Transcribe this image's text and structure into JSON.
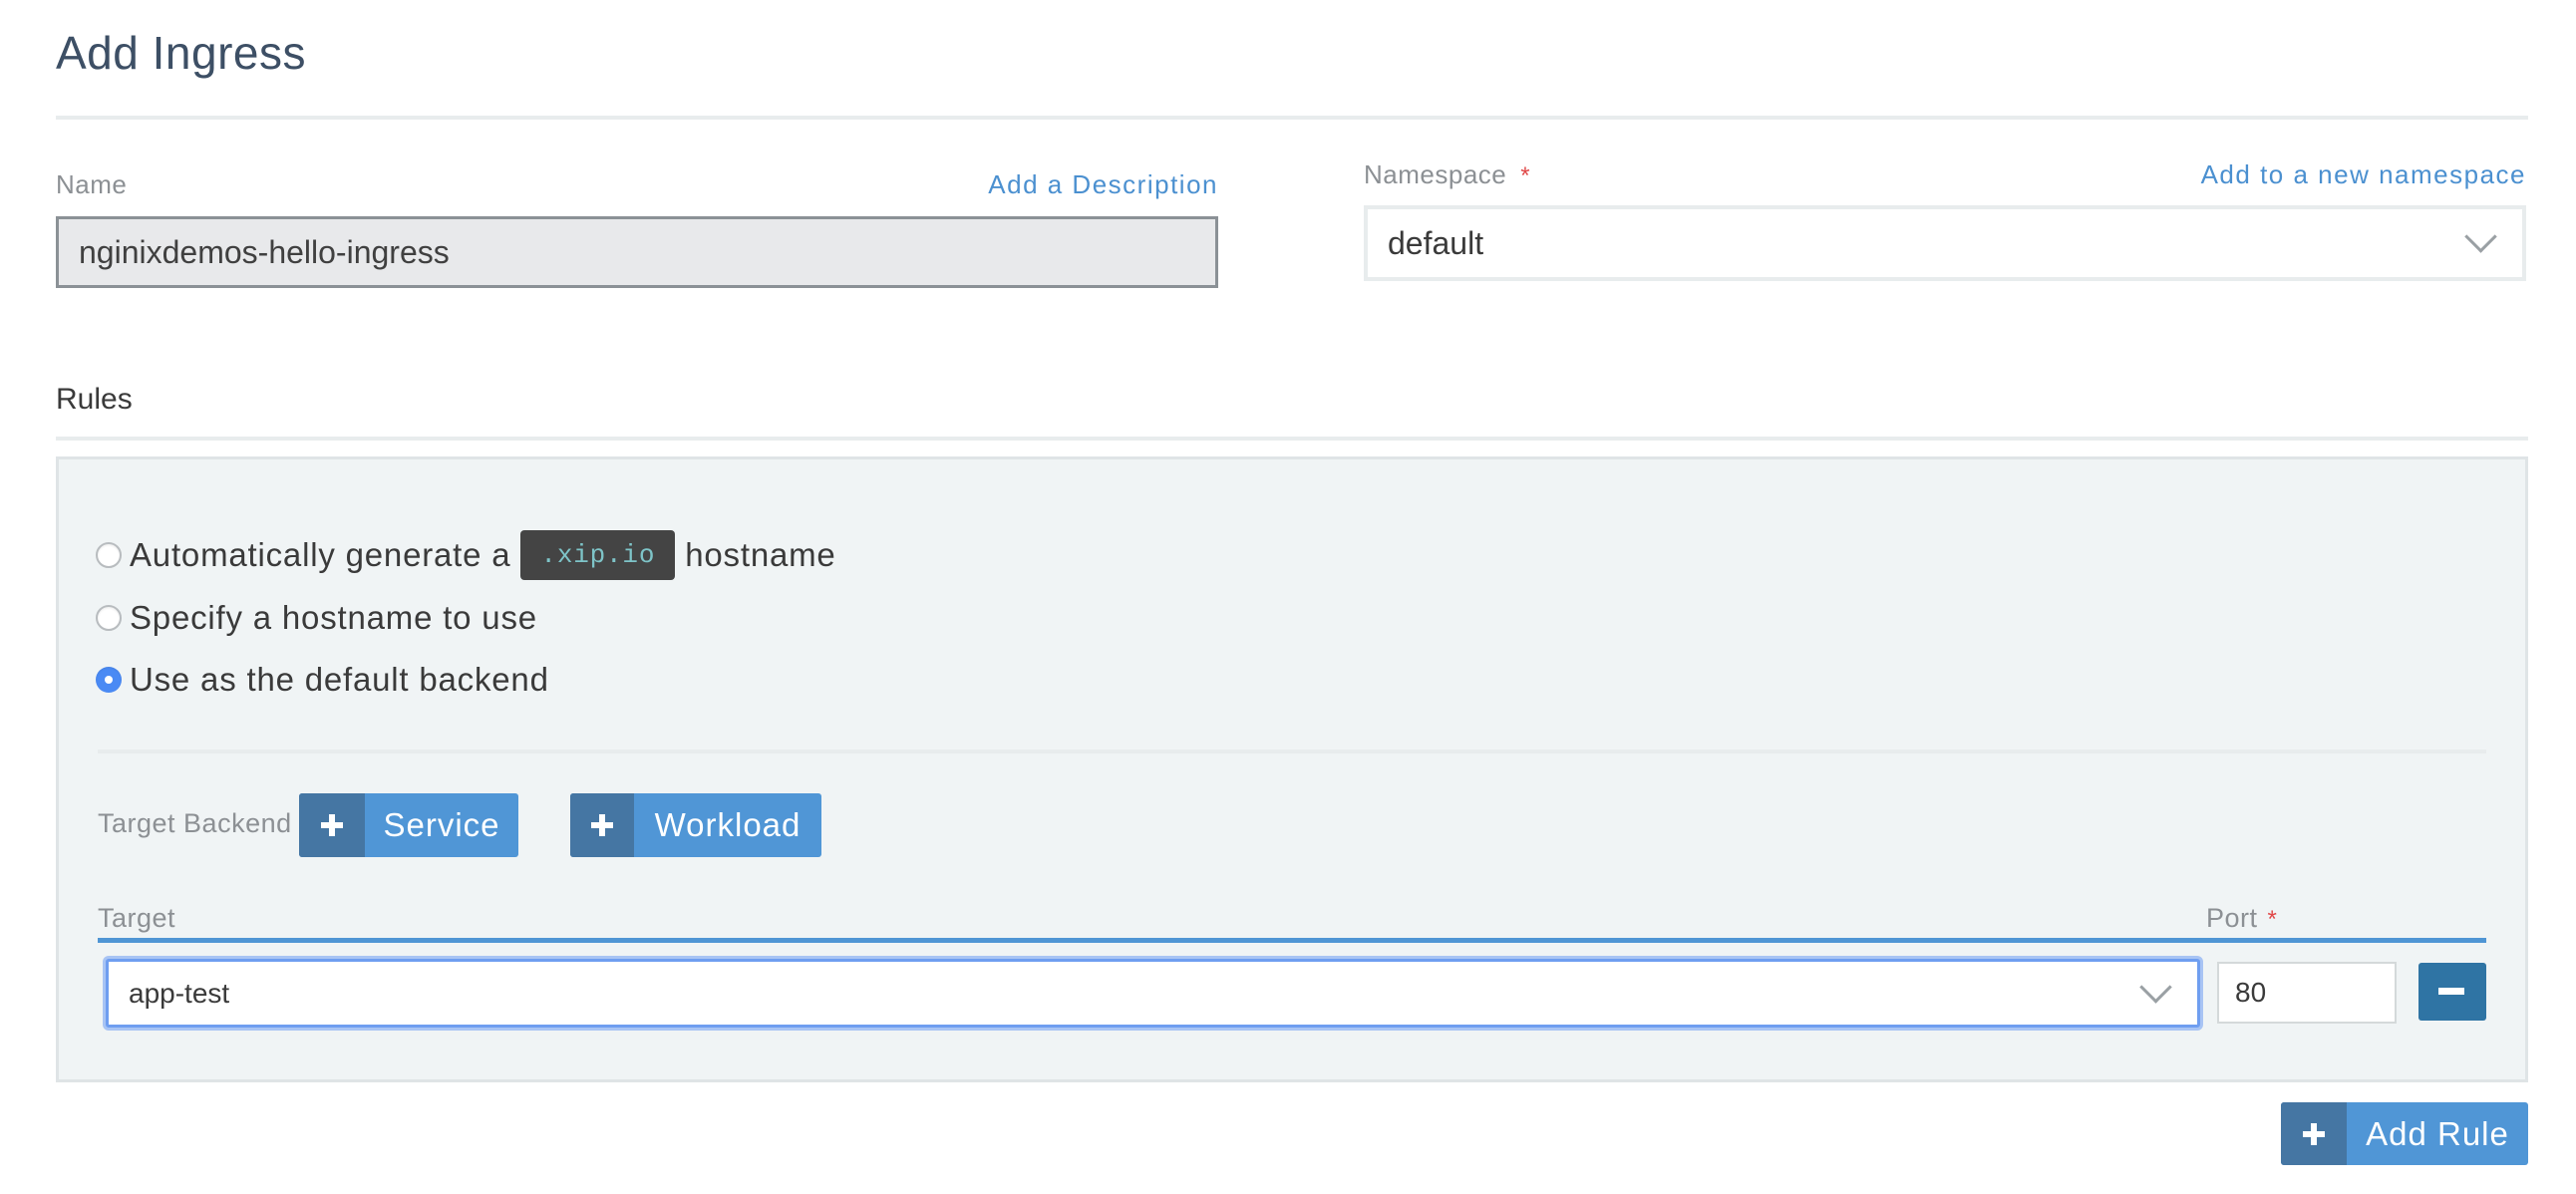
{
  "page": {
    "title": "Add Ingress"
  },
  "name_field": {
    "label": "Name",
    "add_description_link": "Add a Description",
    "value": "nginixdemos-hello-ingress"
  },
  "namespace_field": {
    "label": "Namespace",
    "required_marker": "*",
    "add_namespace_link": "Add to a new namespace",
    "selected": "default"
  },
  "rules": {
    "section_title": "Rules",
    "hostname_options": [
      {
        "label_before": "Automatically generate a",
        "code": ".xip.io",
        "label_after": "hostname",
        "checked": false
      },
      {
        "label": "Specify a hostname to use",
        "checked": false
      },
      {
        "label": "Use as the default backend",
        "checked": true
      }
    ],
    "target_backend": {
      "label": "Target Backend",
      "buttons": [
        {
          "icon": "plus-icon",
          "label": "Service"
        },
        {
          "icon": "plus-icon",
          "label": "Workload"
        }
      ]
    },
    "table": {
      "target_header": "Target",
      "port_header": "Port",
      "port_required_marker": "*",
      "rows": [
        {
          "target": "app-test",
          "port": "80",
          "remove_icon": "minus-icon"
        }
      ]
    },
    "add_rule_button": {
      "icon": "plus-icon",
      "label": "Add Rule"
    }
  },
  "colors": {
    "accent": "#5096d6",
    "accent_dark": "#4576a3",
    "remove_button": "#2f74a4",
    "required": "#e04848",
    "link": "#4b90d0",
    "radio_checked": "#4a8af4"
  }
}
